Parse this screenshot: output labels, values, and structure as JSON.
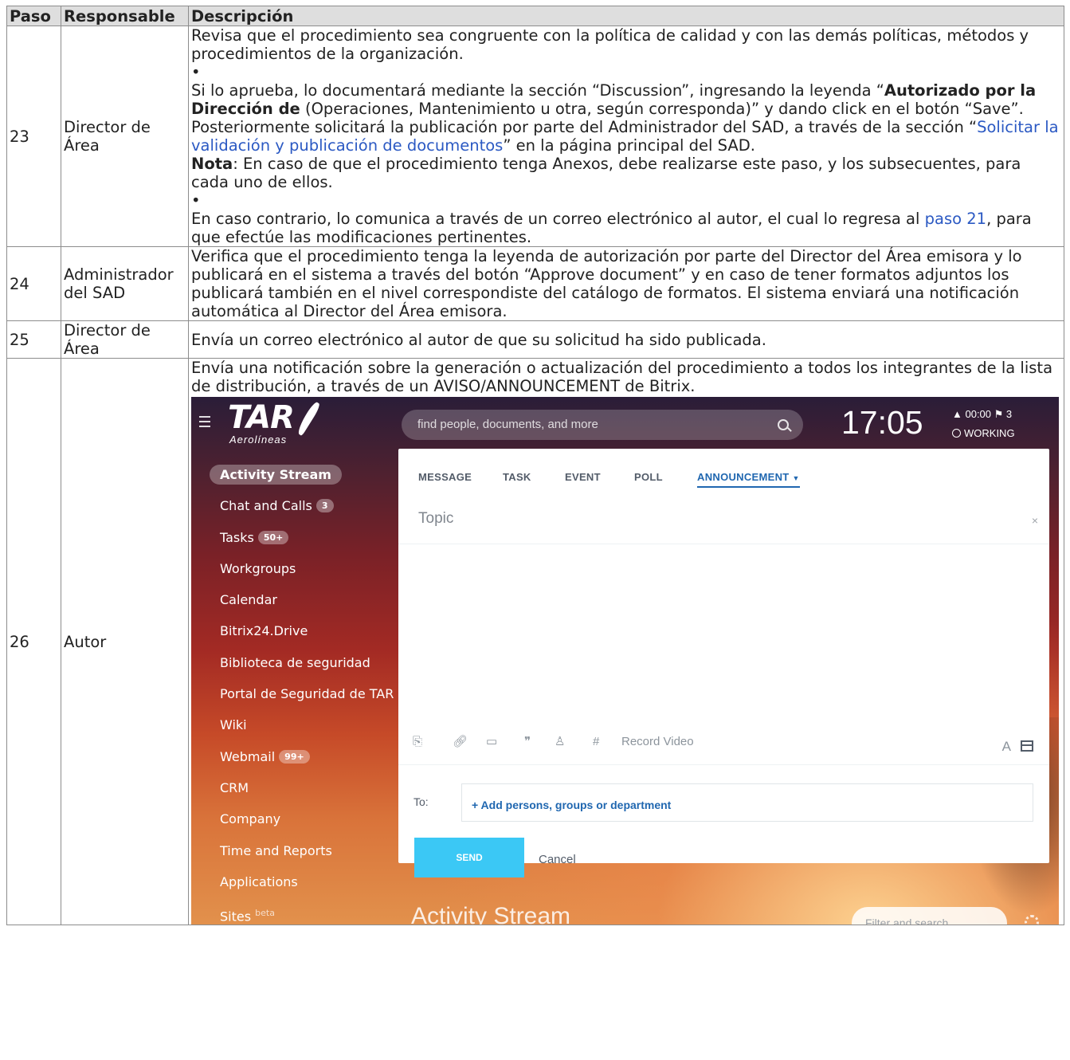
{
  "table": {
    "headers": [
      "Paso",
      "Responsable",
      "Descripción"
    ],
    "rows": [
      {
        "step": "23",
        "owner_line1": "Director de",
        "owner_line2": "Área",
        "p1": "Revisa que el procedimiento sea congruente con la política de calidad y con las demás políticas, métodos y procedimientos de la organización.",
        "bullet": "•",
        "p2_a": "Si lo aprueba, lo documentará mediante la sección “Discussion”, ingresando la leyenda “",
        "p2_bold": "Autorizado por la Dirección de",
        "p2_b": " (Operaciones, Mantenimiento u otra, según corresponda)” y dando click en el botón “Save”. Posteriormente solicitará la publicación por parte del Administrador del SAD, a través de la sección “",
        "p2_link": "Solicitar la validación y publicación de documentos",
        "p2_c": "” en la página principal del SAD.",
        "note_label": "Nota",
        "note_text": ": En caso de que el procedimiento tenga Anexos, debe realizarse este paso, y los subsecuentes, para cada uno de ellos.",
        "p3_a": "En caso contrario, lo comunica a través de un correo electrónico al autor, el cual lo regresa al ",
        "p3_link": "paso 21",
        "p3_b": ", para que efectúe las modificaciones pertinentes."
      },
      {
        "step": "24",
        "owner_line1": "Administrador",
        "owner_line2": "del SAD",
        "text": "Verifica que el procedimiento tenga la leyenda de autorización por parte del Director del Área emisora y lo publicará en el sistema a través del botón “Approve document” y en caso de tener formatos adjuntos los publicará también en el nivel correspondiste del catálogo de formatos. El sistema enviará una notificación automática al Director del Área emisora."
      },
      {
        "step": "25",
        "owner_line1": "Director de",
        "owner_line2": "Área",
        "text": "Envía un correo electrónico al autor de que su solicitud ha sido publicada."
      },
      {
        "step": "26",
        "owner_line1": "Autor",
        "text": "Envía una notificación sobre la generación o actualización del procedimiento a todos los integrantes de la lista de distribución, a través de un AVISO/ANNOUNCEMENT de Bitrix."
      }
    ]
  },
  "bitrix": {
    "logo_main": "TAR",
    "logo_sub": "Aerolíneas",
    "search_placeholder": "find people, documents, and more",
    "clock": "17:05",
    "alarm": "▲ 00:00   ⚑ 3",
    "status": "WORKING",
    "nav": [
      {
        "label": "Activity Stream",
        "badge": ""
      },
      {
        "label": "Chat and Calls",
        "badge": "3"
      },
      {
        "label": "Tasks",
        "badge": "50+"
      },
      {
        "label": "Workgroups",
        "badge": ""
      },
      {
        "label": "Calendar",
        "badge": ""
      },
      {
        "label": "Bitrix24.Drive",
        "badge": ""
      },
      {
        "label": "Biblioteca de seguridad",
        "badge": ""
      },
      {
        "label": "Portal de Seguridad de TAR",
        "badge": ""
      },
      {
        "label": "Wiki",
        "badge": ""
      },
      {
        "label": "Webmail",
        "badge": "99+"
      },
      {
        "label": "CRM",
        "badge": ""
      },
      {
        "label": "Company",
        "badge": ""
      },
      {
        "label": "Time and Reports",
        "badge": ""
      },
      {
        "label": "Applications",
        "badge": ""
      },
      {
        "label": "Sites",
        "badge": "",
        "sup": "beta"
      }
    ],
    "tabs": [
      "MESSAGE",
      "TASK",
      "EVENT",
      "POLL",
      "ANNOUNCEMENT"
    ],
    "topic_placeholder": "Topic",
    "close_glyph": "×",
    "tools": {
      "record_video": "Record Video",
      "font_glyph": "A"
    },
    "to_label": "To:",
    "add_persons": "+ Add persons, groups or department",
    "send_label": "SEND",
    "cancel_label": "Cancel",
    "bottom_title": "Activity Stream",
    "filter_placeholder": "Filter and search"
  }
}
